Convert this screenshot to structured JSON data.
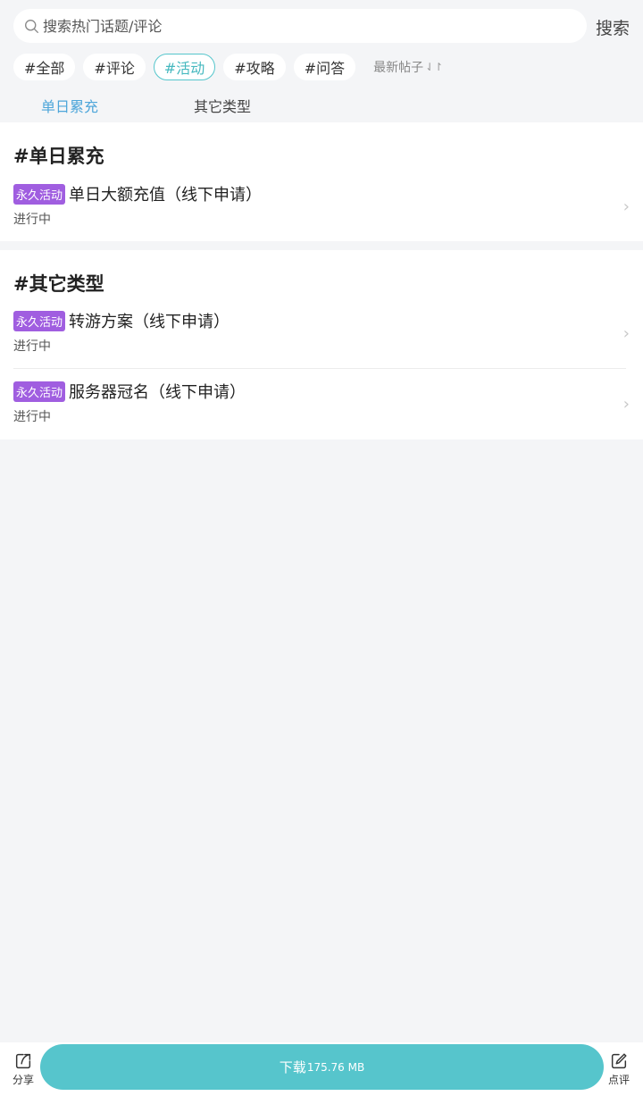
{
  "search": {
    "placeholder": "搜索热门话题/评论",
    "button_label": "搜索"
  },
  "chips": [
    {
      "label": "#全部",
      "active": false
    },
    {
      "label": "#评论",
      "active": false
    },
    {
      "label": "#活动",
      "active": true
    },
    {
      "label": "#攻略",
      "active": false
    },
    {
      "label": "#问答",
      "active": false
    }
  ],
  "sort": {
    "label": "最新帖子",
    "icon": "sort-arrows-icon"
  },
  "subtabs": [
    {
      "label": "单日累充",
      "active": true
    },
    {
      "label": "其它类型",
      "active": false
    }
  ],
  "sections": [
    {
      "title": "#单日累充",
      "items": [
        {
          "tag": "永久活动",
          "title": "单日大额充值（线下申请）",
          "status": "进行中"
        }
      ]
    },
    {
      "title": "#其它类型",
      "items": [
        {
          "tag": "永久活动",
          "title": "转游方案（线下申请）",
          "status": "进行中"
        },
        {
          "tag": "永久活动",
          "title": "服务器冠名（线下申请）",
          "status": "进行中"
        }
      ]
    }
  ],
  "bottom_bar": {
    "share_label": "分享",
    "download_label": "下载",
    "download_size": "175.76 MB",
    "review_label": "点评"
  },
  "colors": {
    "accent": "#56c5cc",
    "tag_purple": "#a05ee0",
    "active_tab": "#4ea6da"
  }
}
